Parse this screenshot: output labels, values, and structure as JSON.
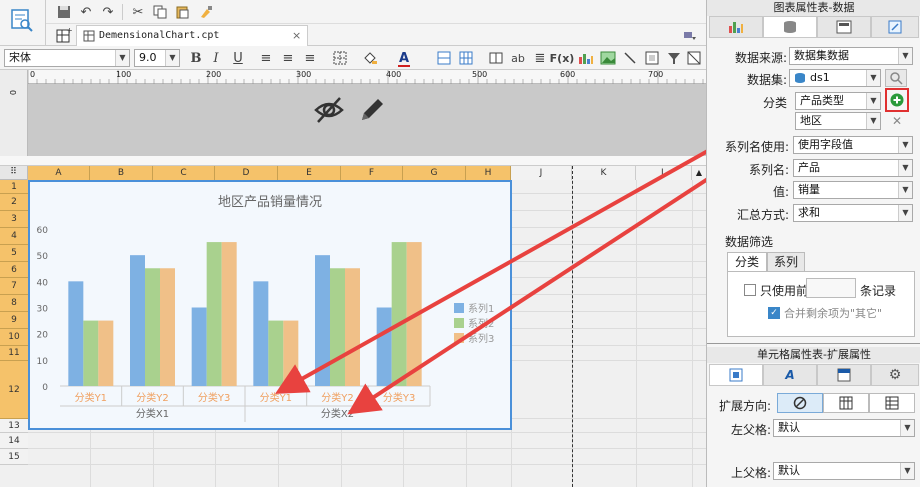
{
  "file_tab": {
    "name": "DemensionalChart.cpt"
  },
  "format_bar": {
    "font": "宋体",
    "size": "9.0"
  },
  "ruler": {
    "marks": [
      "0",
      "100",
      "200",
      "300",
      "400",
      "500",
      "600",
      "700"
    ]
  },
  "columns": [
    "A",
    "B",
    "C",
    "D",
    "E",
    "F",
    "G",
    "H",
    "J",
    "K",
    "L"
  ],
  "rows": [
    "1",
    "2",
    "3",
    "4",
    "5",
    "6",
    "7",
    "8",
    "9",
    "10",
    "11",
    "12",
    "13",
    "14",
    "15"
  ],
  "chart_data": {
    "type": "bar",
    "title": "地区产品销量情况",
    "categories": [
      "分类Y1",
      "分类Y2",
      "分类Y3",
      "分类Y1",
      "分类Y2",
      "分类Y3"
    ],
    "groups": [
      "分类X1",
      "分类X2"
    ],
    "series": [
      {
        "name": "系列1",
        "values": [
          40,
          50,
          30,
          40,
          50,
          30
        ],
        "color": "#7eb1e3"
      },
      {
        "name": "系列2",
        "values": [
          25,
          45,
          55,
          25,
          45,
          55
        ],
        "color": "#a9d18e"
      },
      {
        "name": "系列3",
        "values": [
          25,
          45,
          55,
          25,
          45,
          55
        ],
        "color": "#f0c088"
      }
    ],
    "yticks": [
      "0",
      "10",
      "20",
      "30",
      "40",
      "50",
      "60"
    ],
    "ylim": [
      0,
      60
    ],
    "legend": "right",
    "grid": false
  },
  "panel_top": {
    "title": "图表属性表-数据",
    "data_source_label": "数据来源:",
    "data_source_value": "数据集数据",
    "dataset_label": "数据集:",
    "dataset_value": "ds1",
    "category_label": "分类",
    "category_value": "产品类型",
    "category_value2": "地区",
    "series_name_use_label": "系列名使用:",
    "series_name_use_value": "使用字段值",
    "series_name_label": "系列名:",
    "series_name_value": "产品",
    "value_label": "值:",
    "value_value": "销量",
    "summary_label": "汇总方式:",
    "summary_value": "求和",
    "filter_title": "数据筛选",
    "filter_tabs": [
      "分类",
      "系列"
    ],
    "use_first_label": "只使用前",
    "records_label": "条记录",
    "merge_label": "合并剩余项为\"其它\""
  },
  "panel_bottom": {
    "title": "单元格属性表-扩展属性",
    "expand_dir_label": "扩展方向:",
    "left_parent_label": "左父格:",
    "left_parent_value": "默认",
    "top_parent_label": "上父格:",
    "top_parent_value": "默认"
  },
  "colors": {
    "arrow": "#e8423f",
    "header_selected": "#f5c26a",
    "accent": "#4a90d9"
  }
}
